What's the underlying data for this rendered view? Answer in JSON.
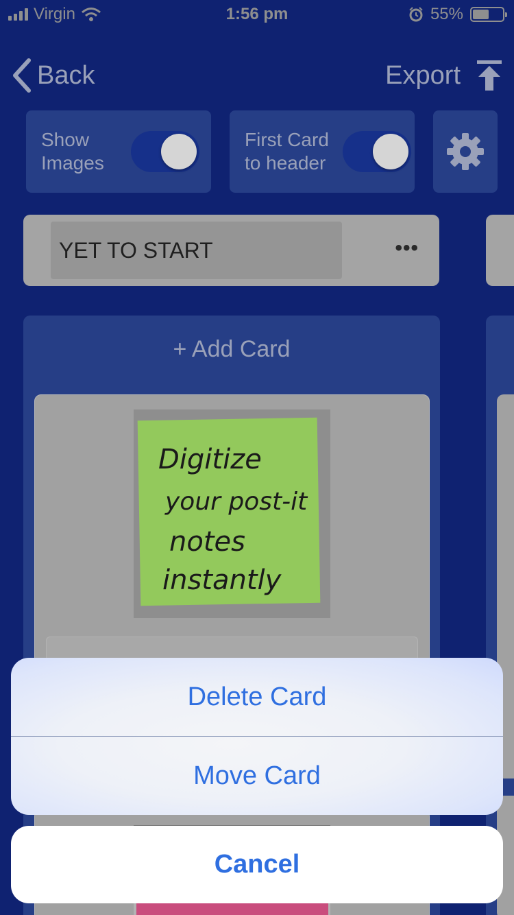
{
  "status_bar": {
    "carrier": "Virgin",
    "time": "1:56 pm",
    "battery_percent": "55%",
    "battery_level": 0.55,
    "icons": [
      "signal-icon",
      "wifi-icon",
      "alarm-icon",
      "battery-icon"
    ]
  },
  "nav": {
    "back_label": "Back",
    "export_label": "Export"
  },
  "toggles": {
    "show_images": {
      "line1": "Show",
      "line2": "Images",
      "on": true
    },
    "first_card": {
      "line1": "First Card",
      "line2": "to header",
      "on": true
    }
  },
  "column": {
    "title": "YET TO START",
    "more_label": "•••",
    "add_card_label": "+ Add Card"
  },
  "card": {
    "image_text": [
      "Digitize",
      "your post-it",
      "notes",
      "instantly"
    ]
  },
  "action_sheet": {
    "delete_label": "Delete Card",
    "move_label": "Move Card",
    "cancel_label": "Cancel"
  },
  "colors": {
    "background": "#0f2271",
    "panel": "#263e86",
    "accent": "#2f6fe0",
    "note_green": "#93c95c"
  }
}
